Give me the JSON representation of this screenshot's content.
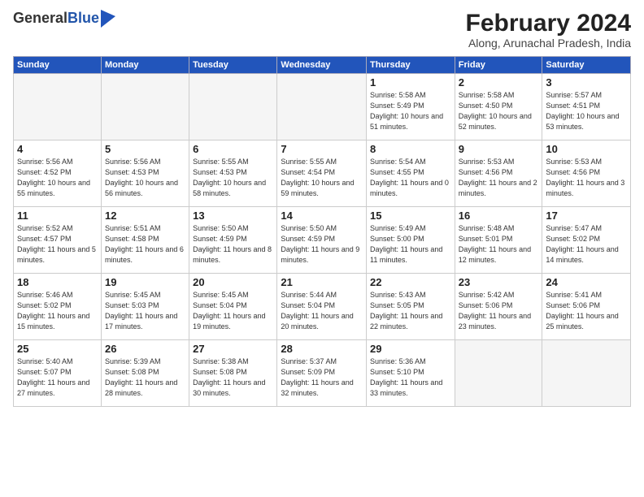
{
  "header": {
    "logo_general": "General",
    "logo_blue": "Blue",
    "month_year": "February 2024",
    "location": "Along, Arunachal Pradesh, India"
  },
  "weekdays": [
    "Sunday",
    "Monday",
    "Tuesday",
    "Wednesday",
    "Thursday",
    "Friday",
    "Saturday"
  ],
  "weeks": [
    [
      {
        "day": null
      },
      {
        "day": null
      },
      {
        "day": null
      },
      {
        "day": null
      },
      {
        "day": 1,
        "sunrise": "5:58 AM",
        "sunset": "5:49 PM",
        "daylight": "10 hours and 51 minutes."
      },
      {
        "day": 2,
        "sunrise": "5:58 AM",
        "sunset": "4:50 PM",
        "daylight": "10 hours and 52 minutes."
      },
      {
        "day": 3,
        "sunrise": "5:57 AM",
        "sunset": "4:51 PM",
        "daylight": "10 hours and 53 minutes."
      }
    ],
    [
      {
        "day": 4,
        "sunrise": "5:56 AM",
        "sunset": "4:52 PM",
        "daylight": "10 hours and 55 minutes."
      },
      {
        "day": 5,
        "sunrise": "5:56 AM",
        "sunset": "4:53 PM",
        "daylight": "10 hours and 56 minutes."
      },
      {
        "day": 6,
        "sunrise": "5:55 AM",
        "sunset": "4:53 PM",
        "daylight": "10 hours and 58 minutes."
      },
      {
        "day": 7,
        "sunrise": "5:55 AM",
        "sunset": "4:54 PM",
        "daylight": "10 hours and 59 minutes."
      },
      {
        "day": 8,
        "sunrise": "5:54 AM",
        "sunset": "4:55 PM",
        "daylight": "11 hours and 0 minutes."
      },
      {
        "day": 9,
        "sunrise": "5:53 AM",
        "sunset": "4:56 PM",
        "daylight": "11 hours and 2 minutes."
      },
      {
        "day": 10,
        "sunrise": "5:53 AM",
        "sunset": "4:56 PM",
        "daylight": "11 hours and 3 minutes."
      }
    ],
    [
      {
        "day": 11,
        "sunrise": "5:52 AM",
        "sunset": "4:57 PM",
        "daylight": "11 hours and 5 minutes."
      },
      {
        "day": 12,
        "sunrise": "5:51 AM",
        "sunset": "4:58 PM",
        "daylight": "11 hours and 6 minutes."
      },
      {
        "day": 13,
        "sunrise": "5:50 AM",
        "sunset": "4:59 PM",
        "daylight": "11 hours and 8 minutes."
      },
      {
        "day": 14,
        "sunrise": "5:50 AM",
        "sunset": "4:59 PM",
        "daylight": "11 hours and 9 minutes."
      },
      {
        "day": 15,
        "sunrise": "5:49 AM",
        "sunset": "5:00 PM",
        "daylight": "11 hours and 11 minutes."
      },
      {
        "day": 16,
        "sunrise": "5:48 AM",
        "sunset": "5:01 PM",
        "daylight": "11 hours and 12 minutes."
      },
      {
        "day": 17,
        "sunrise": "5:47 AM",
        "sunset": "5:02 PM",
        "daylight": "11 hours and 14 minutes."
      }
    ],
    [
      {
        "day": 18,
        "sunrise": "5:46 AM",
        "sunset": "5:02 PM",
        "daylight": "11 hours and 15 minutes."
      },
      {
        "day": 19,
        "sunrise": "5:45 AM",
        "sunset": "5:03 PM",
        "daylight": "11 hours and 17 minutes."
      },
      {
        "day": 20,
        "sunrise": "5:45 AM",
        "sunset": "5:04 PM",
        "daylight": "11 hours and 19 minutes."
      },
      {
        "day": 21,
        "sunrise": "5:44 AM",
        "sunset": "5:04 PM",
        "daylight": "11 hours and 20 minutes."
      },
      {
        "day": 22,
        "sunrise": "5:43 AM",
        "sunset": "5:05 PM",
        "daylight": "11 hours and 22 minutes."
      },
      {
        "day": 23,
        "sunrise": "5:42 AM",
        "sunset": "5:06 PM",
        "daylight": "11 hours and 23 minutes."
      },
      {
        "day": 24,
        "sunrise": "5:41 AM",
        "sunset": "5:06 PM",
        "daylight": "11 hours and 25 minutes."
      }
    ],
    [
      {
        "day": 25,
        "sunrise": "5:40 AM",
        "sunset": "5:07 PM",
        "daylight": "11 hours and 27 minutes."
      },
      {
        "day": 26,
        "sunrise": "5:39 AM",
        "sunset": "5:08 PM",
        "daylight": "11 hours and 28 minutes."
      },
      {
        "day": 27,
        "sunrise": "5:38 AM",
        "sunset": "5:08 PM",
        "daylight": "11 hours and 30 minutes."
      },
      {
        "day": 28,
        "sunrise": "5:37 AM",
        "sunset": "5:09 PM",
        "daylight": "11 hours and 32 minutes."
      },
      {
        "day": 29,
        "sunrise": "5:36 AM",
        "sunset": "5:10 PM",
        "daylight": "11 hours and 33 minutes."
      },
      {
        "day": null
      },
      {
        "day": null
      }
    ]
  ]
}
